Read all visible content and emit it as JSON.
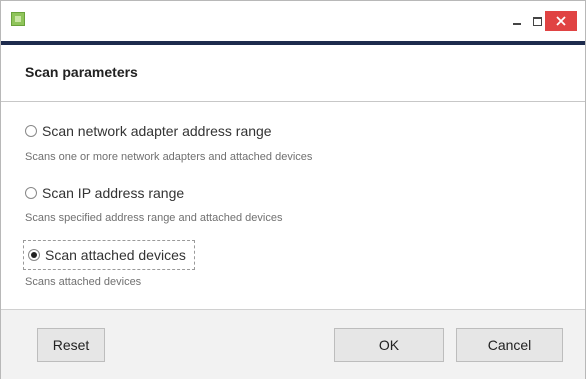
{
  "header": {
    "title": "Scan parameters"
  },
  "options": [
    {
      "label": "Scan network adapter address range",
      "description": "Scans one or more network adapters and attached devices",
      "selected": false
    },
    {
      "label": "Scan IP address range",
      "description": "Scans specified address range and attached devices",
      "selected": false
    },
    {
      "label": "Scan attached devices",
      "description": "Scans attached devices",
      "selected": true
    }
  ],
  "footer": {
    "reset_label": "Reset",
    "ok_label": "OK",
    "cancel_label": "Cancel"
  },
  "colors": {
    "close_button": "#e04343",
    "title_accent": "#1d2b4d",
    "app_icon": "#8fc45a"
  },
  "icons": {
    "app": "app-icon",
    "minimize": "minimize-icon",
    "maximize": "maximize-icon",
    "close": "close-icon"
  }
}
